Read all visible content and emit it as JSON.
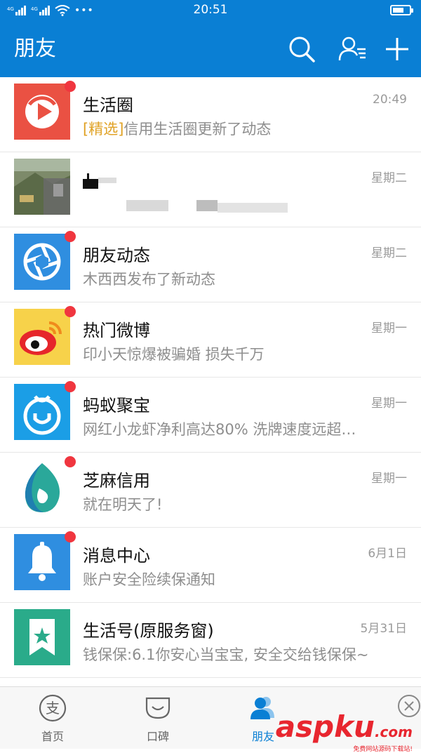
{
  "status_bar": {
    "time": "20:51",
    "signal1": "4G",
    "signal2": "4G",
    "battery_level": 0.7
  },
  "header": {
    "title": "朋友",
    "icons": [
      "search-icon",
      "contacts-icon",
      "add-icon"
    ]
  },
  "conversations": [
    {
      "name": "生活圈",
      "tag": "[精选]",
      "preview": "信用生活圈更新了动态",
      "time": "20:49",
      "unread": true,
      "icon": "life-circle-icon",
      "color": "#ea5143"
    },
    {
      "name": "",
      "tag": "",
      "preview": "",
      "time": "星期二",
      "unread": false,
      "icon": "photo-avatar",
      "color": "#6b6b55"
    },
    {
      "name": "朋友动态",
      "tag": "",
      "preview": "木西西发布了新动态",
      "time": "星期二",
      "unread": true,
      "icon": "shutter-icon",
      "color": "#2f8ee0"
    },
    {
      "name": "热门微博",
      "tag": "",
      "preview": "印小天惊爆被骗婚 损失千万",
      "time": "星期一",
      "unread": true,
      "icon": "weibo-icon",
      "color": "#f7d24a"
    },
    {
      "name": "蚂蚁聚宝",
      "tag": "",
      "preview": "网红小龙虾净利高达80% 洗牌速度远超…",
      "time": "星期一",
      "unread": true,
      "icon": "ant-fortune-icon",
      "color": "#1b9ee6"
    },
    {
      "name": "芝麻信用",
      "tag": "",
      "preview": "就在明天了!",
      "time": "星期一",
      "unread": true,
      "icon": "sesame-icon",
      "color": "#2aa89a"
    },
    {
      "name": "消息中心",
      "tag": "",
      "preview": "账户安全险续保通知",
      "time": "6月1日",
      "unread": true,
      "icon": "bell-icon",
      "color": "#2f8ee0"
    },
    {
      "name": "生活号(原服务窗)",
      "tag": "",
      "preview": "钱保保:6.1你安心当宝宝, 安全交给钱保保~",
      "time": "5月31日",
      "unread": false,
      "icon": "bookmark-star-icon",
      "color": "#2aab8a"
    }
  ],
  "tabs": [
    {
      "label": "首页",
      "icon": "home-icon",
      "active": false
    },
    {
      "label": "口碑",
      "icon": "koubei-icon",
      "active": false
    },
    {
      "label": "朋友",
      "icon": "friends-icon",
      "active": true
    }
  ],
  "watermark": {
    "main": "aspku",
    "sub": ".com",
    "tagline": "免费网站源码下载站!"
  }
}
